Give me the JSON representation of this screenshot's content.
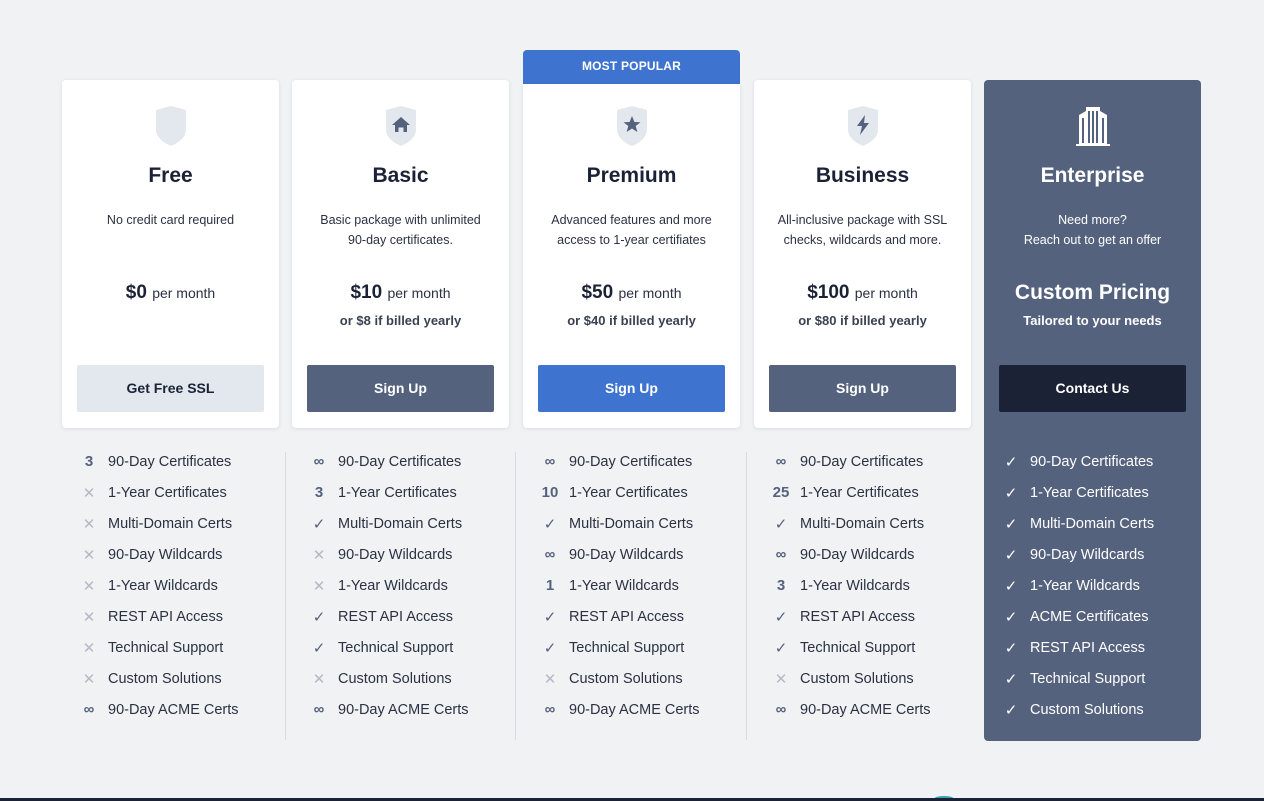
{
  "badge": "MOST POPULAR",
  "plans": [
    {
      "name": "Free",
      "desc1": "No credit card required",
      "desc2": "",
      "price": "$0",
      "per": "per month",
      "billed": "",
      "cta": "Get Free SSL",
      "icon": "shield-icon"
    },
    {
      "name": "Basic",
      "desc1": "Basic package with unlimited",
      "desc2": "90-day certificates.",
      "price": "$10",
      "per": "per month",
      "billed": "or $8 if billed yearly",
      "cta": "Sign Up",
      "icon": "shield-home-icon"
    },
    {
      "name": "Premium",
      "desc1": "Advanced features and more",
      "desc2": "access to 1-year certifiates",
      "price": "$50",
      "per": "per month",
      "billed": "or $40 if billed yearly",
      "cta": "Sign Up",
      "icon": "shield-star-icon"
    },
    {
      "name": "Business",
      "desc1": "All-inclusive package with SSL",
      "desc2": "checks, wildcards and more.",
      "price": "$100",
      "per": "per month",
      "billed": "or $80 if billed yearly",
      "cta": "Sign Up",
      "icon": "shield-bolt-icon"
    },
    {
      "name": "Enterprise",
      "desc1": "Need more?",
      "desc2": "Reach out to get an offer",
      "price": "Custom Pricing",
      "per": "",
      "billed": "Tailored to your needs",
      "cta": "Contact Us",
      "icon": "building-icon"
    }
  ],
  "features": [
    [
      {
        "mark": "3",
        "label": "90-Day Certificates"
      },
      {
        "mark": "✕",
        "label": "1-Year Certificates"
      },
      {
        "mark": "✕",
        "label": "Multi-Domain Certs"
      },
      {
        "mark": "✕",
        "label": "90-Day Wildcards"
      },
      {
        "mark": "✕",
        "label": "1-Year Wildcards"
      },
      {
        "mark": "✕",
        "label": "REST API Access"
      },
      {
        "mark": "✕",
        "label": "Technical Support"
      },
      {
        "mark": "✕",
        "label": "Custom Solutions"
      },
      {
        "mark": "∞",
        "label": "90-Day ACME Certs"
      }
    ],
    [
      {
        "mark": "∞",
        "label": "90-Day Certificates"
      },
      {
        "mark": "3",
        "label": "1-Year Certificates"
      },
      {
        "mark": "✓",
        "label": "Multi-Domain Certs"
      },
      {
        "mark": "✕",
        "label": "90-Day Wildcards"
      },
      {
        "mark": "✕",
        "label": "1-Year Wildcards"
      },
      {
        "mark": "✓",
        "label": "REST API Access"
      },
      {
        "mark": "✓",
        "label": "Technical Support"
      },
      {
        "mark": "✕",
        "label": "Custom Solutions"
      },
      {
        "mark": "∞",
        "label": "90-Day ACME Certs"
      }
    ],
    [
      {
        "mark": "∞",
        "label": "90-Day Certificates"
      },
      {
        "mark": "10",
        "label": "1-Year Certificates"
      },
      {
        "mark": "✓",
        "label": "Multi-Domain Certs"
      },
      {
        "mark": "∞",
        "label": "90-Day Wildcards"
      },
      {
        "mark": "1",
        "label": "1-Year Wildcards"
      },
      {
        "mark": "✓",
        "label": "REST API Access"
      },
      {
        "mark": "✓",
        "label": "Technical Support"
      },
      {
        "mark": "✕",
        "label": "Custom Solutions"
      },
      {
        "mark": "∞",
        "label": "90-Day ACME Certs"
      }
    ],
    [
      {
        "mark": "∞",
        "label": "90-Day Certificates"
      },
      {
        "mark": "25",
        "label": "1-Year Certificates"
      },
      {
        "mark": "✓",
        "label": "Multi-Domain Certs"
      },
      {
        "mark": "∞",
        "label": "90-Day Wildcards"
      },
      {
        "mark": "3",
        "label": "1-Year Wildcards"
      },
      {
        "mark": "✓",
        "label": "REST API Access"
      },
      {
        "mark": "✓",
        "label": "Technical Support"
      },
      {
        "mark": "✕",
        "label": "Custom Solutions"
      },
      {
        "mark": "∞",
        "label": "90-Day ACME Certs"
      }
    ],
    [
      {
        "mark": "✓",
        "label": "90-Day Certificates"
      },
      {
        "mark": "✓",
        "label": "1-Year Certificates"
      },
      {
        "mark": "✓",
        "label": "Multi-Domain Certs"
      },
      {
        "mark": "✓",
        "label": "90-Day Wildcards"
      },
      {
        "mark": "✓",
        "label": "1-Year Wildcards"
      },
      {
        "mark": "✓",
        "label": "ACME Certificates"
      },
      {
        "mark": "✓",
        "label": "REST API Access"
      },
      {
        "mark": "✓",
        "label": "Technical Support"
      },
      {
        "mark": "✓",
        "label": "Custom Solutions"
      }
    ]
  ],
  "colors": {
    "accent": "#3e74cf",
    "slate": "#55627e",
    "navy": "#1b2236",
    "background": "#f1f2f4"
  }
}
